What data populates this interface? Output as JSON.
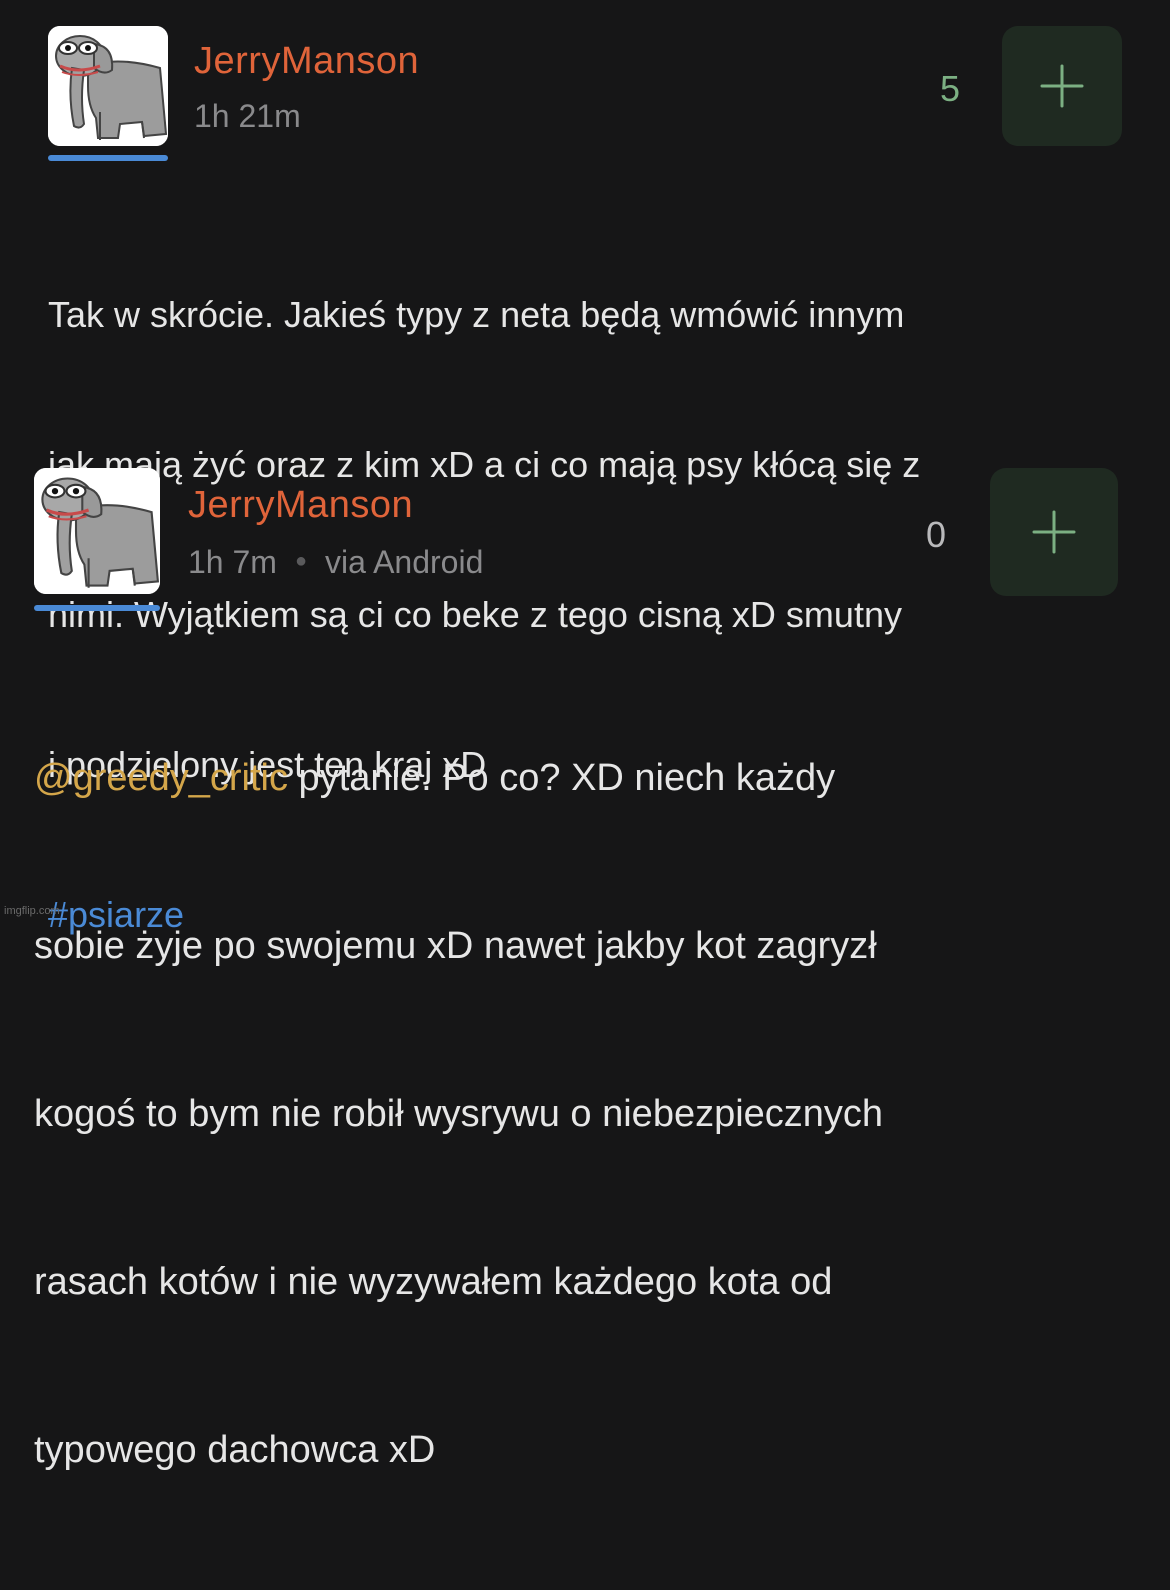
{
  "posts": [
    {
      "username": "JerryManson",
      "time": "1h 21m",
      "via": "",
      "score": "5",
      "score_color": "#7cb083",
      "body_lines": [
        "Tak w skrócie. Jakieś typy z neta będą wmówić innym",
        "jak mają żyć oraz z kim xD a ci co mają psy kłócą się z",
        "nimi. Wyjątkiem są ci co beke z tego cisną xD smutny",
        "i podzielony jest ten kraj xD"
      ],
      "tag": "#psiarze"
    },
    {
      "username": "JerryManson",
      "time": "1h 7m",
      "via": "via Android",
      "score": "0",
      "score_color": "#b9b9bb",
      "mention": "@greedy_critic",
      "body_lines": [
        " pytanie. Po co? XD niech każdy",
        "sobie żyje po swojemu xD nawet jakby kot zagryzł",
        "kogoś to bym nie robił wysrywu o niebezpiecznych",
        "rasach kotów i nie wyzywałem każdego kota od",
        "typowego dachowca xD"
      ]
    }
  ],
  "colors": {
    "background": "#161617",
    "username": "#e0643a",
    "meta": "#8a8a8c",
    "hashtag": "#4a8ad6",
    "mention": "#d4a64a",
    "plus_button_bg": "#1f2a21",
    "plus_icon": "#7cb083"
  },
  "icons": {
    "avatar": "elephant-avatar-icon",
    "plus": "plus-icon"
  },
  "watermark": "imgflip.com"
}
